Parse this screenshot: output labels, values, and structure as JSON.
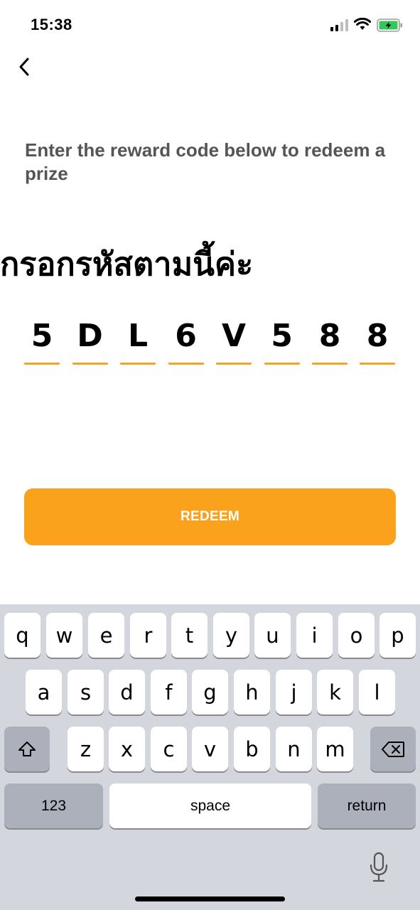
{
  "status_bar": {
    "time": "15:38"
  },
  "instruction": "Enter the reward code below to redeem a prize",
  "heading": "กรอกรหัสตามนี้ค่ะ",
  "code": [
    "5",
    "D",
    "L",
    "6",
    "V",
    "5",
    "8",
    "8"
  ],
  "redeem_button": {
    "label": "REDEEM"
  },
  "keyboard": {
    "row1": [
      "q",
      "w",
      "e",
      "r",
      "t",
      "y",
      "u",
      "i",
      "o",
      "p"
    ],
    "row2": [
      "a",
      "s",
      "d",
      "f",
      "g",
      "h",
      "j",
      "k",
      "l"
    ],
    "row3": [
      "z",
      "x",
      "c",
      "v",
      "b",
      "n",
      "m"
    ],
    "numbers_label": "123",
    "space_label": "space",
    "return_label": "return",
    "shift_icon": "shift-icon",
    "delete_icon": "delete-icon",
    "mic_icon": "microphone-icon"
  },
  "colors": {
    "accent": "#FAA21B",
    "keyboard_bg": "#D3D6DC",
    "key_dark": "#ABB0BA"
  }
}
